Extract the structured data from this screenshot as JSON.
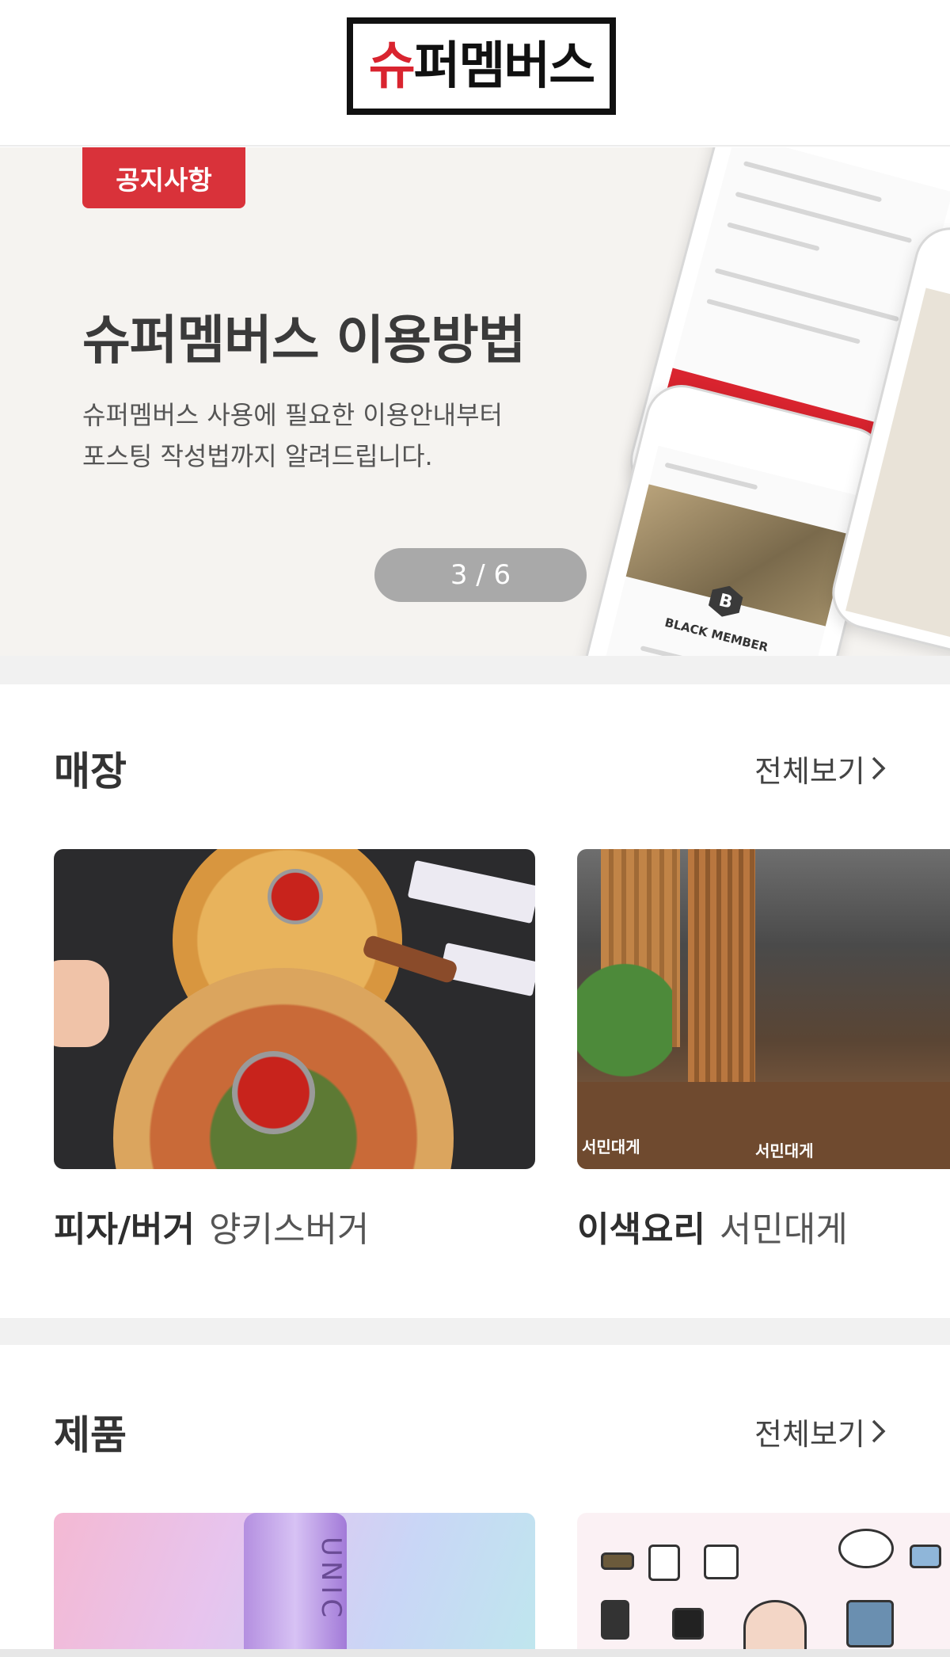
{
  "header": {
    "logo_first_char": "슈",
    "logo_rest": "퍼멤버스"
  },
  "banner": {
    "tag": "공지사항",
    "title": "슈퍼멤버스 이용방법",
    "description_line1": "슈퍼멤버스 사용에 필요한 이용안내부터",
    "description_line2": "포스팅 작성법까지 알려드립니다.",
    "pager": "3 / 6",
    "mockup": {
      "black_member": "BLACK MEMBER",
      "badge": "B"
    }
  },
  "stores": {
    "title": "매장",
    "see_all": "전체보기",
    "items": [
      {
        "category": "피자/버거",
        "name": "양키스버거",
        "image": "pizza-photo"
      },
      {
        "category": "이색요리",
        "name": "서민대게",
        "image": "restaurant-photo",
        "sign_text": "서민대게"
      }
    ]
  },
  "products": {
    "title": "제품",
    "see_all": "전체보기",
    "items": [
      {
        "image": "cosmetic-bottle-photo",
        "label": "UNIC"
      },
      {
        "image": "clothing-doodle-illustration"
      }
    ]
  },
  "colors": {
    "brand_red": "#d9242f",
    "notice_tag": "#d9323a",
    "pager_bg": "#a9a9a9"
  },
  "icons": {
    "see_all_arrow": "chevron-right-icon"
  }
}
